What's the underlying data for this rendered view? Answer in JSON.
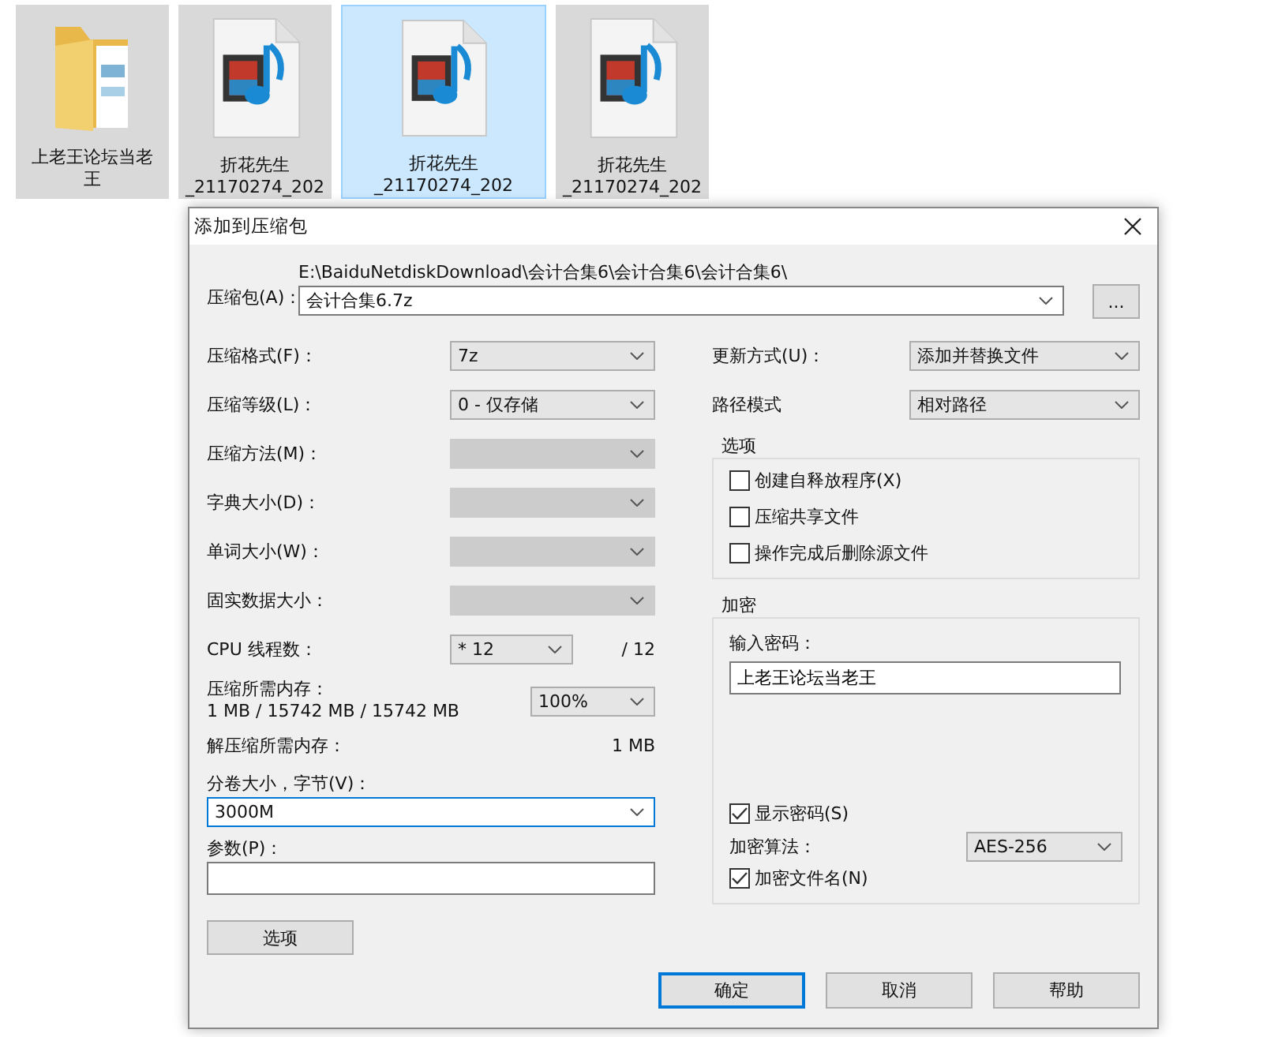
{
  "desktop_items": [
    {
      "kind": "folder",
      "selected": false,
      "lines": [
        "上老王论坛当老",
        "王"
      ]
    },
    {
      "kind": "video",
      "selected": false,
      "lines": [
        "折花先生",
        "_21170274_202"
      ]
    },
    {
      "kind": "video",
      "selected": true,
      "lines": [
        "折花先生",
        "_21170274_202"
      ]
    },
    {
      "kind": "video",
      "selected": false,
      "lines": [
        "折花先生",
        "_21170274_202"
      ]
    }
  ],
  "dialog": {
    "title": "添加到压缩包",
    "archive": {
      "label": "压缩包(A)：",
      "path": "E:\\BaiduNetdiskDownload\\会计合集6\\会计合集6\\会计合集6\\",
      "value": "会计合集6.7z",
      "browse": "..."
    },
    "left_fields": [
      {
        "label": "压缩格式(F)：",
        "value": "7z",
        "disabled": false
      },
      {
        "label": "压缩等级(L)：",
        "value": "0 - 仅存储",
        "disabled": false
      },
      {
        "label": "压缩方法(M)：",
        "disabled": true
      },
      {
        "label": "字典大小(D)：",
        "disabled": true
      },
      {
        "label": "单词大小(W)：",
        "disabled": true
      },
      {
        "label": "固实数据大小：",
        "disabled": true
      }
    ],
    "cpu": {
      "label": "CPU 线程数：",
      "value": "* 12",
      "total": "/ 12"
    },
    "memory": {
      "label": "压缩所需内存：",
      "detail": "1 MB / 15742 MB / 15742 MB",
      "value": "100%"
    },
    "decompress": {
      "label": "解压缩所需内存：",
      "value": "1 MB"
    },
    "volume": {
      "label": "分卷大小，字节(V)：",
      "value": "3000M"
    },
    "params": {
      "label": "参数(P)："
    },
    "options_button": "选项",
    "update": {
      "label": "更新方式(U)：",
      "value": "添加并替换文件"
    },
    "path_mode": {
      "label": "路径模式",
      "value": "相对路径"
    },
    "options_group": {
      "title": "选项",
      "checkboxes": [
        {
          "label": "创建自释放程序(X)",
          "checked": false
        },
        {
          "label": "压缩共享文件",
          "checked": false
        },
        {
          "label": "操作完成后删除源文件",
          "checked": false
        }
      ]
    },
    "encryption": {
      "title": "加密",
      "password_label": "输入密码：",
      "password": "上老王论坛当老王",
      "show_password": {
        "label": "显示密码(S)",
        "checked": true
      },
      "method": {
        "label": "加密算法：",
        "value": "AES-256"
      },
      "encrypt_names": {
        "label": "加密文件名(N)",
        "checked": true
      }
    },
    "buttons": [
      {
        "label": "确定",
        "focused": true
      },
      {
        "label": "取消",
        "focused": false
      },
      {
        "label": "帮助",
        "focused": false
      }
    ]
  }
}
